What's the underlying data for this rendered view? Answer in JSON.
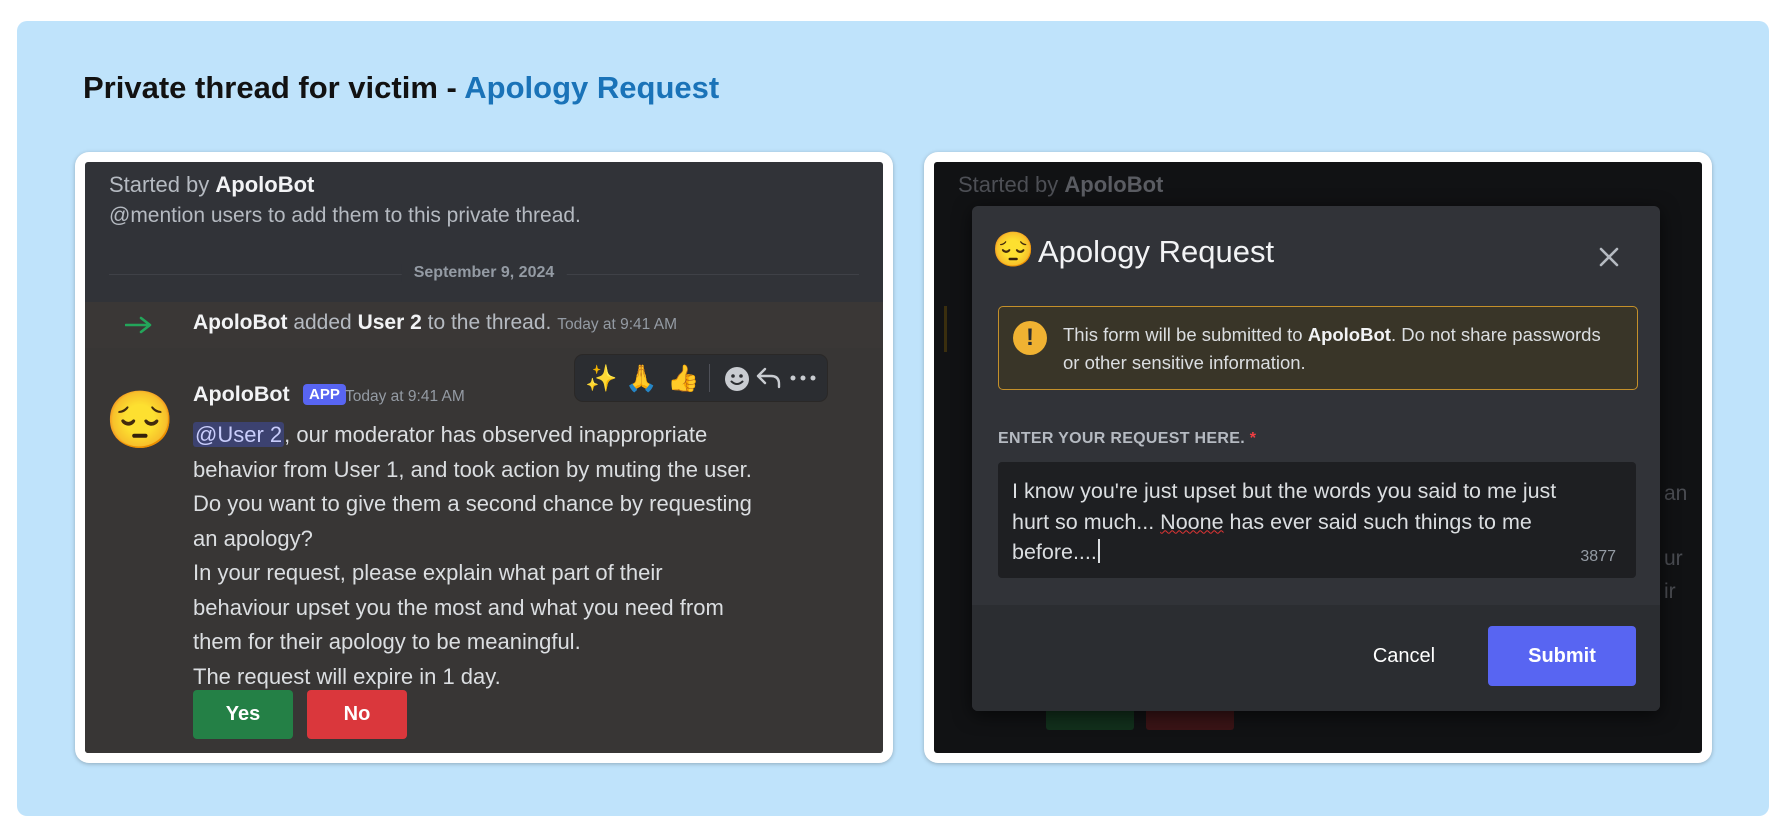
{
  "page": {
    "heading_prefix": "Private thread for victim - ",
    "heading_accent": "Apology Request"
  },
  "thread": {
    "started_prefix": "Started by ",
    "started_bot": "ApoloBot",
    "hint": "@mention users to add them to this private thread.",
    "date_divider": "September 9, 2024",
    "system_bot": "ApoloBot",
    "system_mid": " added ",
    "system_user": "User 2",
    "system_end": " to the thread.",
    "system_time": "Today at 9:41 AM",
    "author": "ApoloBot",
    "badge": "APP",
    "time": "Today at 9:41 AM",
    "mention": "@User 2",
    "line1_rest": ", our moderator has observed inappropriate",
    "line2": "behavior from User 1, and took action by muting the user.",
    "line3": "Do you want to give them a second chance by requesting",
    "line4": "an apology?",
    "line5": "In your request, please explain what part of their",
    "line6": "behaviour upset you the most and what you need from",
    "line7": "them for their apology to be meaningful.",
    "line8": "The request will expire in 1 day.",
    "yes_label": "Yes",
    "no_label": "No",
    "avatar_emoji": "😔",
    "reactions": [
      "✨",
      "🙏",
      "👍"
    ]
  },
  "modal": {
    "behind_started_prefix": "Started by ",
    "behind_started_bot": "ApoloBot",
    "emoji": "😔",
    "title": "Apology Request",
    "warning_prefix": "This form will be submitted to ",
    "warning_bot": "ApoloBot",
    "warning_suffix": ". Do not share passwords or other sensitive information.",
    "field_label": "ENTER YOUR REQUEST HERE.",
    "required_mark": "*",
    "text_part1": "I know you're just upset but the words you said to me just hurt so much... ",
    "text_misspelled": "Noone",
    "text_part2": " has ever said such things to me before....",
    "char_count": "3877",
    "cancel_label": "Cancel",
    "submit_label": "Submit",
    "behind_fragments": [
      "an",
      "ur",
      "ir"
    ]
  },
  "colors": {
    "frame_bg": "#bfe3fb",
    "accent_title": "#1a73b8",
    "discord_bg": "#313338",
    "blurple": "#5865f2",
    "success": "#248046",
    "danger": "#da373c",
    "warning": "#f0b232"
  }
}
